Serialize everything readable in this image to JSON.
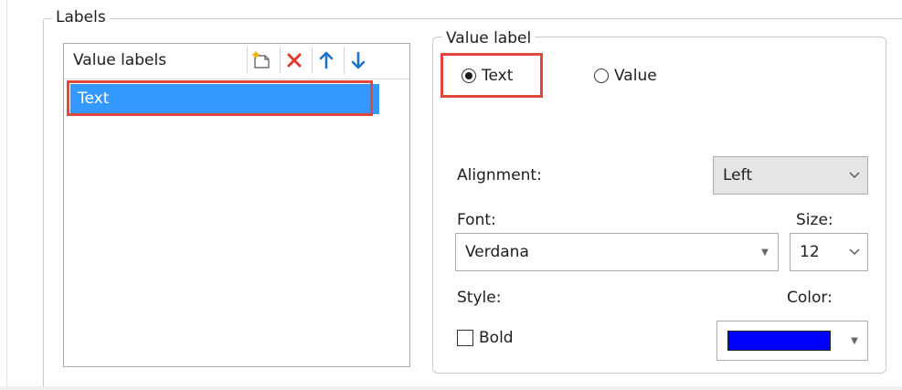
{
  "labels_group": {
    "title": "Labels"
  },
  "value_labels_list": {
    "header": "Value labels",
    "items": [
      "Text"
    ],
    "toolbar": {
      "new_icon": "new-document-icon",
      "delete_icon": "delete-x-icon",
      "move_up_icon": "arrow-up-icon",
      "move_down_icon": "arrow-down-icon"
    }
  },
  "value_label_group": {
    "title": "Value label",
    "radio_text": "Text",
    "radio_value": "Value",
    "selected": "Text"
  },
  "alignment": {
    "label": "Alignment:",
    "value": "Left"
  },
  "font": {
    "label": "Font:",
    "value": "Verdana"
  },
  "size": {
    "label": "Size:",
    "value": "12"
  },
  "style": {
    "label": "Style:",
    "bold_label": "Bold",
    "bold_checked": false
  },
  "color": {
    "label": "Color:",
    "value": "#0000ff"
  },
  "highlight_color": "#e0473f",
  "selection_color": "#3399ff"
}
